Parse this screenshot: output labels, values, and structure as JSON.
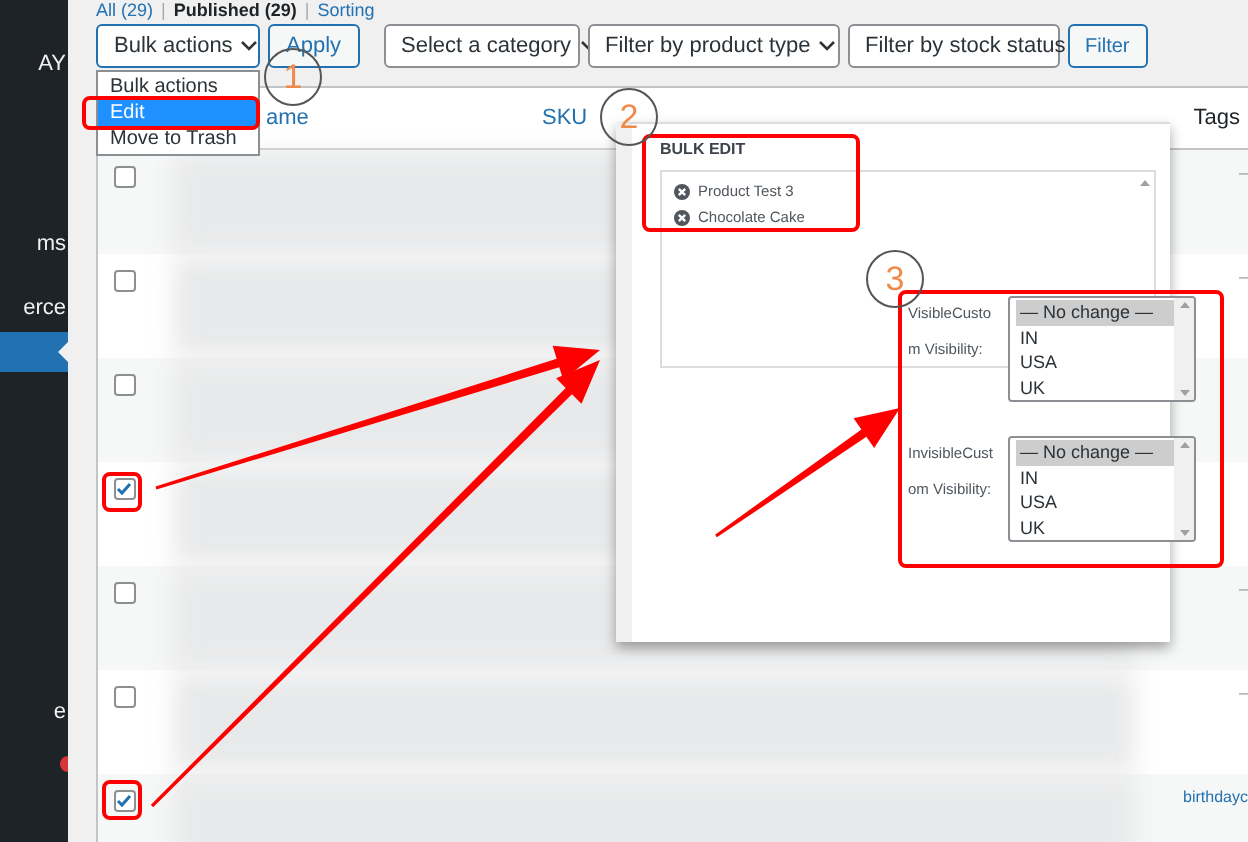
{
  "sidebar": {
    "items": [
      {
        "label": "AY",
        "current": false
      },
      {
        "label": "ms",
        "current": false
      },
      {
        "label": "erce",
        "current": false
      },
      {
        "current": true
      },
      {
        "label": "e",
        "current": false
      }
    ]
  },
  "status_separator": "|",
  "status_links": [
    {
      "label": "All (29)",
      "selected": false
    },
    {
      "label": "Published (29)",
      "selected": true
    },
    {
      "label": "Sorting",
      "selected": false
    }
  ],
  "toolbar": {
    "bulk_actions": "Bulk actions",
    "apply": "Apply",
    "filters": [
      "Select a category",
      "Filter by product type",
      "Filter by stock status"
    ],
    "filter_button": "Filter"
  },
  "bulk_dropdown": {
    "options": [
      {
        "label": "Bulk actions",
        "selected": false
      },
      {
        "label": "Edit",
        "selected": true
      },
      {
        "label": "Move to Trash",
        "selected": false
      }
    ]
  },
  "table": {
    "columns": [
      "ame",
      "SKU",
      "Tags"
    ],
    "rows": [
      {
        "checked": false,
        "tags": "–"
      },
      {
        "checked": false,
        "tags": "–"
      },
      {
        "checked": false
      },
      {
        "checked": true
      },
      {
        "checked": false,
        "tags": "–"
      },
      {
        "checked": false,
        "tags": "–"
      },
      {
        "checked": true,
        "tags": "birthdayc"
      }
    ]
  },
  "bulk_edit": {
    "title": "BULK EDIT",
    "items": [
      "Product Test 3",
      "Chocolate Cake"
    ],
    "fields": [
      {
        "label_lines": [
          "VisibleCusto",
          "m Visibility:"
        ],
        "options": [
          {
            "label": "— No change —",
            "selected": true
          },
          {
            "label": "IN",
            "selected": false
          },
          {
            "label": "USA",
            "selected": false
          },
          {
            "label": "UK",
            "selected": false
          }
        ]
      },
      {
        "label_lines": [
          "InvisibleCust",
          "om Visibility:"
        ],
        "options": [
          {
            "label": "— No change —",
            "selected": true
          },
          {
            "label": "IN",
            "selected": false
          },
          {
            "label": "USA",
            "selected": false
          },
          {
            "label": "UK",
            "selected": false
          }
        ]
      }
    ]
  },
  "annotations": [
    "1",
    "2",
    "3"
  ]
}
